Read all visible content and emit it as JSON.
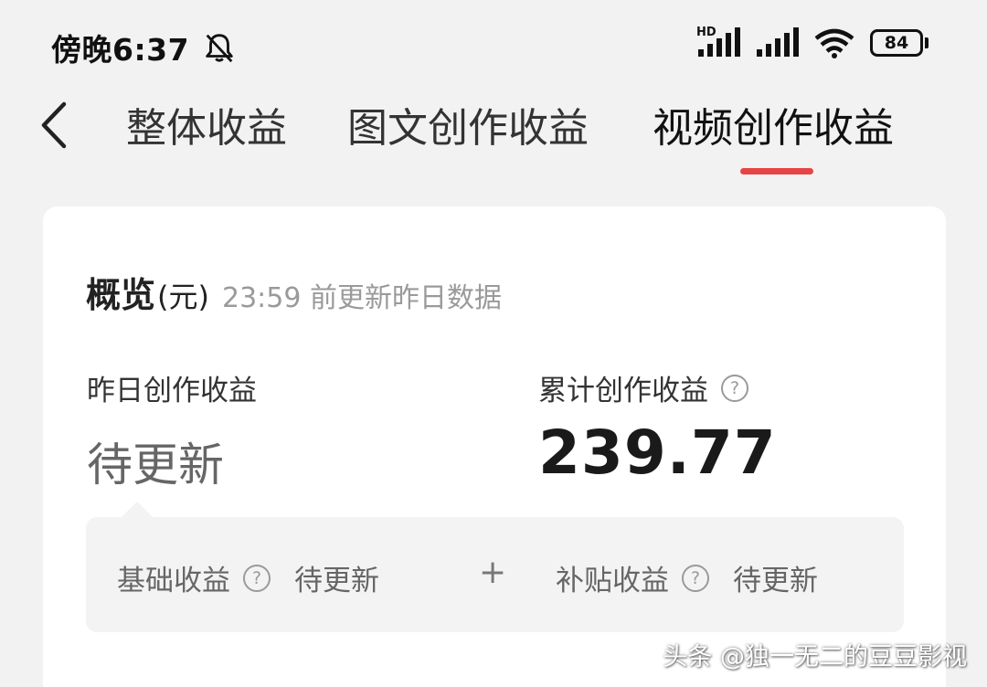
{
  "status_bar": {
    "time": "傍晚6:37",
    "signal_hd_label": "HD",
    "battery_level": "84"
  },
  "tabs": [
    {
      "label": "整体收益",
      "active": false
    },
    {
      "label": "图文创作收益",
      "active": false
    },
    {
      "label": "视频创作收益",
      "active": true
    }
  ],
  "overview": {
    "title": "概览",
    "unit": "(元)",
    "subtitle": "23:59 前更新昨日数据"
  },
  "yesterday": {
    "label": "昨日创作收益",
    "value": "待更新"
  },
  "cumulative": {
    "label": "累计创作收益",
    "value": "239.77"
  },
  "breakdown": {
    "base_label": "基础收益",
    "base_value": "待更新",
    "plus": "+",
    "subsidy_label": "补贴收益",
    "subsidy_value": "待更新"
  },
  "watermark": "头条 @独一无二的豆豆影视",
  "colors": {
    "accent": "#e64545",
    "background": "#f2f2f2",
    "card": "#ffffff"
  },
  "icons": [
    "bell-off-icon",
    "cellular-signal-icon",
    "wifi-icon",
    "battery-icon",
    "chevron-left-icon",
    "help-circle-icon"
  ]
}
